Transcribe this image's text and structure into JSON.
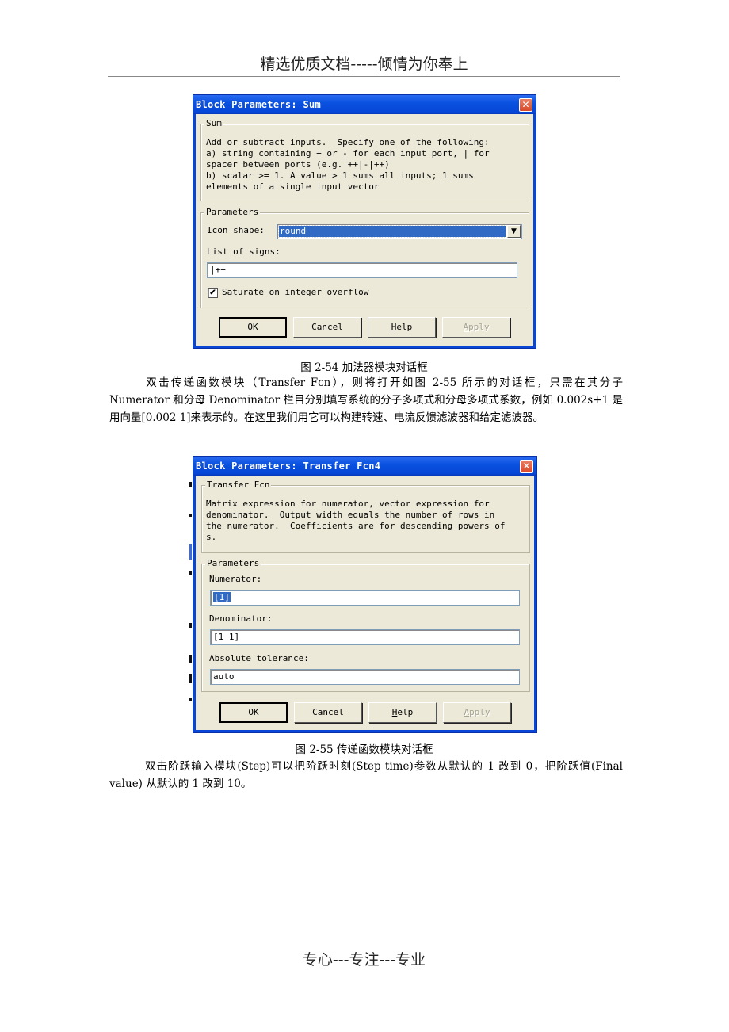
{
  "page": {
    "header": "精选优质文档-----倾情为你奉上",
    "footer": "专心---专注---专业"
  },
  "dialog_sum": {
    "title": "Block Parameters: Sum",
    "close_icon": "close-icon",
    "group_title": "Sum",
    "description": "Add or subtract inputs.  Specify one of the following:\na) string containing + or - for each input port, | for\nspacer between ports (e.g. ++|-|++)\nb) scalar >= 1. A value > 1 sums all inputs; 1 sums\nelements of a single input vector",
    "params_title": "Parameters",
    "icon_shape_label": "Icon shape:",
    "icon_shape_value": "round",
    "list_of_signs_label": "List of signs:",
    "list_of_signs_value": "|++",
    "saturate_label": "Saturate on integer overflow",
    "saturate_checked": true,
    "buttons": {
      "ok": "OK",
      "cancel": "Cancel",
      "help_u": "H",
      "help_rest": "elp",
      "apply_u": "A",
      "apply_rest": "pply"
    }
  },
  "caption_1": "图 2-54  加法器模块对话框",
  "paragraph_1": "双击传递函数模块（Transfer Fcn），则将打开如图 2-55 所示的对话框，只需在其分子 Numerator 和分母 Denominator 栏目分别填写系统的分子多项式和分母多项式系数，例如 0.002s+1 是用向量[0.002 1]来表示的。在这里我们用它可以构建转速、电流反馈滤波器和给定滤波器。",
  "dialog_tf": {
    "title": "Block Parameters: Transfer Fcn4",
    "group_title": "Transfer Fcn",
    "description": "Matrix expression for numerator, vector expression for\ndenominator.  Output width equals the number of rows in\nthe numerator.  Coefficients are for descending powers of\ns.",
    "params_title": "Parameters",
    "numerator_label": "Numerator:",
    "numerator_value": "[1]",
    "denominator_label": "Denominator:",
    "denominator_value": "[1 1]",
    "abs_tol_label": "Absolute tolerance:",
    "abs_tol_value": "auto",
    "buttons": {
      "ok": "OK",
      "cancel": "Cancel",
      "help_u": "H",
      "help_rest": "elp",
      "apply_u": "A",
      "apply_rest": "pply"
    }
  },
  "caption_2": "图 2-55  传递函数模块对话框",
  "paragraph_2": "双击阶跃输入模块(Step)可以把阶跃时刻(Step time)参数从默认的 1 改到 0，把阶跃值(Final value) 从默认的 1 改到 10。"
}
